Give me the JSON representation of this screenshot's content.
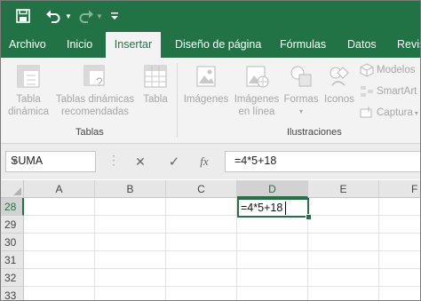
{
  "colors": {
    "brand": "#217346",
    "ribbon_bg": "#f3f3f3",
    "disabled_text": "#a6a6a6"
  },
  "quick_access": {
    "save_icon": "save-icon",
    "undo_icon": "undo-icon",
    "redo_icon": "redo-icon",
    "customize_icon": "customize-qat-icon"
  },
  "tabs": [
    {
      "label": "Archivo",
      "active": false
    },
    {
      "label": "Inicio",
      "active": false
    },
    {
      "label": "Insertar",
      "active": true
    },
    {
      "label": "Diseño de página",
      "active": false
    },
    {
      "label": "Fórmulas",
      "active": false
    },
    {
      "label": "Datos",
      "active": false
    },
    {
      "label": "Revis",
      "active": false
    }
  ],
  "ribbon": {
    "tablas_group": {
      "label": "Tablas",
      "tabla_dinamica": "Tabla dinámica",
      "tablas_recomendadas": "Tablas dinámicas recomendadas",
      "tabla": "Tabla"
    },
    "ilustraciones_group": {
      "label": "Ilustraciones",
      "imagenes": "Imágenes",
      "imagenes_en_linea": "Imágenes en línea",
      "formas": "Formas",
      "iconos": "Iconos",
      "modelos": "Modelos",
      "smartart": "SmartArt",
      "captura": "Captura"
    }
  },
  "formula_bar": {
    "name_box": "SUMA",
    "cancel_symbol": "✕",
    "enter_symbol": "✓",
    "fx_symbol": "fx",
    "formula": "=4*5+18"
  },
  "sheet": {
    "columns": [
      "A",
      "B",
      "C",
      "D",
      "E",
      "F"
    ],
    "rows": [
      "28",
      "29",
      "30",
      "31",
      "32",
      "33"
    ],
    "active_cell": {
      "ref": "D28",
      "value": "=4*5+18"
    }
  }
}
